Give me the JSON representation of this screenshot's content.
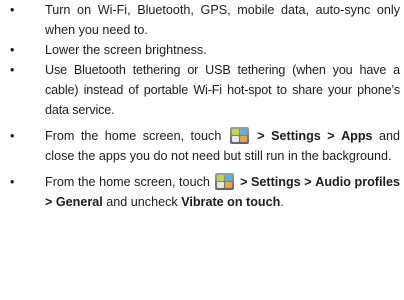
{
  "bullet_char": "•",
  "items": [
    {
      "text": "Turn on Wi-Fi, Bluetooth, GPS, mobile data, auto-sync only when you need to."
    },
    {
      "text": "Lower the screen brightness."
    },
    {
      "text": "Use Bluetooth tethering or USB tethering (when you have a cable) instead of portable Wi-Fi hot-spot to share your phone’s data service."
    },
    {
      "pre": "From the home screen, touch",
      "nav1": "> Settings >",
      "nav2": "Apps",
      "post": "and close the apps you do not need but still run in the background."
    },
    {
      "pre": "From the home screen, touch",
      "nav1": "> Settings >",
      "nav2": "Audio profiles > General",
      "mid": "and uncheck",
      "nav3": "Vibrate on touch",
      "end": "."
    }
  ]
}
